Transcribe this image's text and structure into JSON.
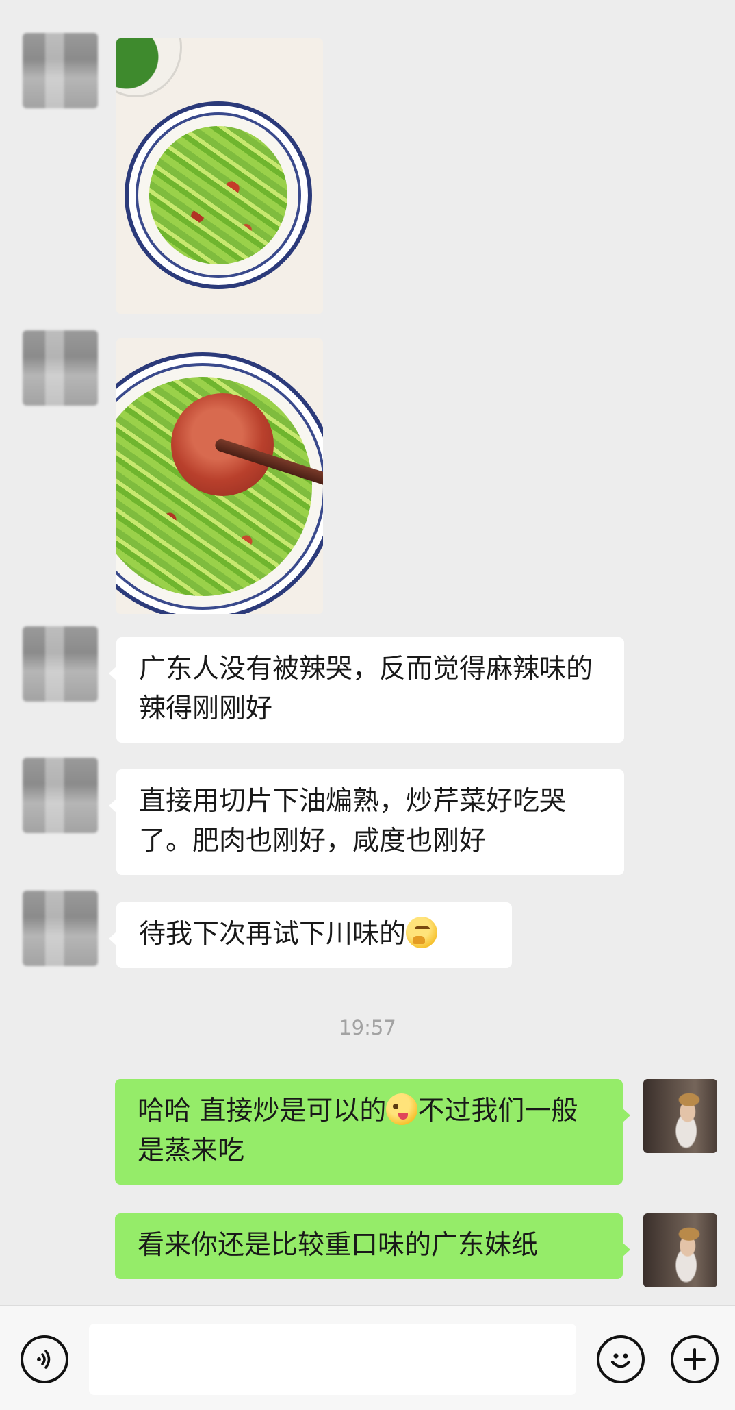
{
  "messages": [
    {
      "type": "image",
      "sender": "other",
      "avatar_icon": "blurred-avatar",
      "image_desc": "stir-fried celery with sausage on blue-rimmed plate"
    },
    {
      "type": "image",
      "sender": "other",
      "avatar_icon": "blurred-avatar",
      "image_desc": "sausage slice held by chopsticks over celery dish"
    },
    {
      "type": "text",
      "sender": "other",
      "text": "广东人没有被辣哭，反而觉得麻辣味的辣得刚刚好"
    },
    {
      "type": "text",
      "sender": "other",
      "text": "直接用切片下油煸熟，炒芹菜好吃哭了。肥肉也刚好，咸度也刚好"
    },
    {
      "type": "text",
      "sender": "other",
      "text": "待我下次再试下川味的",
      "emoji": "thinking-face-emoji"
    },
    {
      "type": "text",
      "sender": "self",
      "text_before": "哈哈 直接炒是可以的",
      "emoji": "winking-tongue-emoji",
      "text_after": "不过我们一般是蒸来吃"
    },
    {
      "type": "text",
      "sender": "self",
      "text": "看来你还是比较重口味的广东妹纸"
    }
  ],
  "timestamp": "19:57",
  "input_bar": {
    "voice_icon": "voice-icon",
    "input_value": "",
    "emoji_icon": "emoji-icon",
    "plus_icon": "plus-icon"
  },
  "colors": {
    "background": "#ededed",
    "sent_bubble": "#95ec69",
    "received_bubble": "#ffffff",
    "timestamp": "#a3a3a3"
  }
}
